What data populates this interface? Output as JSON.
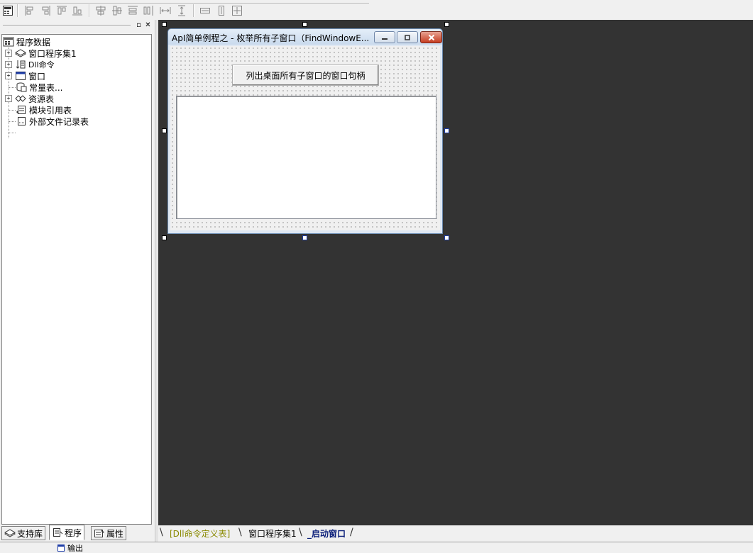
{
  "left_panel": {
    "tree": {
      "root": "程序数据",
      "items": [
        {
          "label": "窗口程序集1",
          "expandable": true
        },
        {
          "label": "Dll命令",
          "expandable": true
        },
        {
          "label": "窗口",
          "expandable": true
        },
        {
          "label": "常量表...",
          "expandable": false
        },
        {
          "label": "资源表",
          "expandable": true
        },
        {
          "label": "模块引用表",
          "expandable": false
        },
        {
          "label": "外部文件记录表",
          "expandable": false
        }
      ]
    },
    "tabs": [
      {
        "label": "支持库"
      },
      {
        "label": "程序"
      },
      {
        "label": "属性"
      }
    ],
    "active_tab": "程序"
  },
  "form": {
    "title": "ApI简单例程之 - 枚举所有子窗口（FindWindowE...",
    "button_label": "列出桌面所有子窗口的窗口句柄"
  },
  "bottom_tabs": [
    {
      "label": "[Dll命令定义表]"
    },
    {
      "label": "窗口程序集1"
    },
    {
      "label": "_启动窗口"
    }
  ],
  "active_bottom_tab": "_启动窗口",
  "status_strip": {
    "output_label": "输出"
  },
  "colors": {
    "design_background": "#333333",
    "active_tab_text": "#0b1f7a",
    "first_tab_text": "#8a8a00"
  }
}
